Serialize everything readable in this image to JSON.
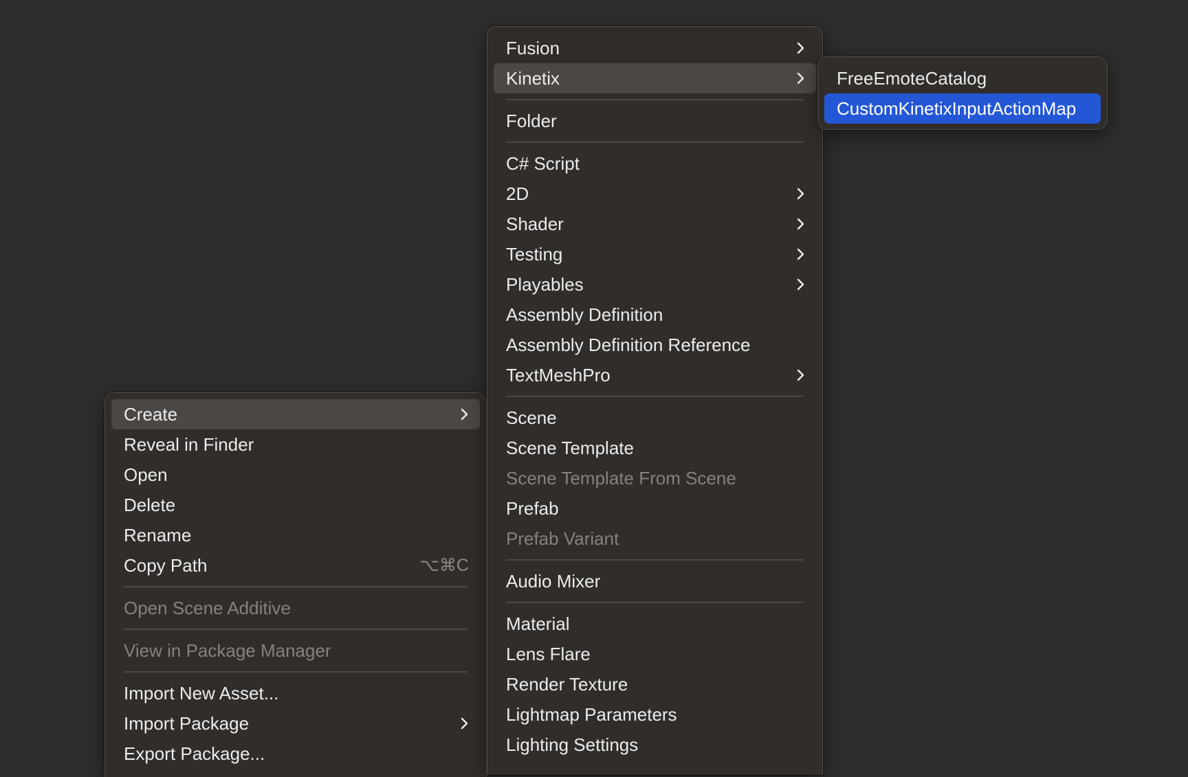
{
  "context_menu": {
    "items": [
      {
        "label": "Create",
        "state": "selected",
        "submenu": true
      },
      {
        "label": "Reveal in Finder"
      },
      {
        "label": "Open"
      },
      {
        "label": "Delete"
      },
      {
        "label": "Rename"
      },
      {
        "label": "Copy Path",
        "shortcut": "⌥⌘C"
      },
      {
        "label": "Open Scene Additive",
        "state": "disabled"
      },
      {
        "label": "View in Package Manager",
        "state": "disabled"
      },
      {
        "label": "Import New Asset..."
      },
      {
        "label": "Import Package",
        "submenu": true
      },
      {
        "label": "Export Package..."
      }
    ]
  },
  "create_menu": {
    "items": [
      {
        "label": "Fusion",
        "submenu": true
      },
      {
        "label": "Kinetix",
        "state": "selected",
        "submenu": true
      },
      {
        "label": "Folder"
      },
      {
        "label": "C# Script"
      },
      {
        "label": "2D",
        "submenu": true
      },
      {
        "label": "Shader",
        "submenu": true
      },
      {
        "label": "Testing",
        "submenu": true
      },
      {
        "label": "Playables",
        "submenu": true
      },
      {
        "label": "Assembly Definition"
      },
      {
        "label": "Assembly Definition Reference"
      },
      {
        "label": "TextMeshPro",
        "submenu": true
      },
      {
        "label": "Scene"
      },
      {
        "label": "Scene Template"
      },
      {
        "label": "Scene Template From Scene",
        "state": "disabled"
      },
      {
        "label": "Prefab"
      },
      {
        "label": "Prefab Variant",
        "state": "disabled"
      },
      {
        "label": "Audio Mixer"
      },
      {
        "label": "Material"
      },
      {
        "label": "Lens Flare"
      },
      {
        "label": "Render Texture"
      },
      {
        "label": "Lightmap Parameters"
      },
      {
        "label": "Lighting Settings"
      }
    ]
  },
  "kinetix_menu": {
    "items": [
      {
        "label": "FreeEmoteCatalog"
      },
      {
        "label": "CustomKinetixInputActionMap",
        "state": "highlighted"
      }
    ]
  },
  "colors": {
    "background": "#2d2d2d",
    "menu_background": "#312d2a",
    "selected_row": "#4b4744",
    "highlight": "#2457d6",
    "text": "#ececec",
    "disabled_text": "#85817d"
  },
  "icons": {
    "submenu": "chevron-right-icon"
  }
}
